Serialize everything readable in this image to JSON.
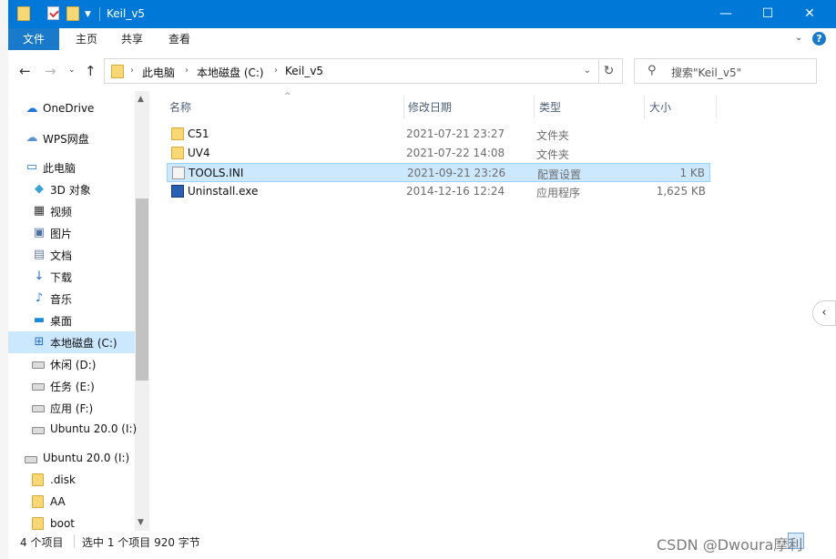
{
  "window": {
    "title": "Keil_v5",
    "minimize_glyph": "—",
    "maximize_glyph": "☐",
    "close_glyph": "✕"
  },
  "ribbon": {
    "tabs": [
      "文件",
      "主页",
      "共享",
      "查看"
    ],
    "help_glyph": "?"
  },
  "address": {
    "crumbs": [
      "此电脑",
      "本地磁盘 (C:)",
      "Keil_v5"
    ],
    "search_placeholder": "搜索\"Keil_v5\""
  },
  "nav": {
    "items": [
      {
        "label": "OneDrive",
        "icon": "cloud-icon"
      },
      {
        "label": "WPS网盘",
        "icon": "cloud-outline-icon"
      },
      {
        "label": "此电脑",
        "icon": "computer-icon"
      },
      {
        "label": "3D 对象",
        "icon": "cube-icon"
      },
      {
        "label": "视频",
        "icon": "video-icon"
      },
      {
        "label": "图片",
        "icon": "picture-icon"
      },
      {
        "label": "文档",
        "icon": "document-icon"
      },
      {
        "label": "下载",
        "icon": "download-icon"
      },
      {
        "label": "音乐",
        "icon": "music-icon"
      },
      {
        "label": "桌面",
        "icon": "desktop-icon"
      },
      {
        "label": "本地磁盘 (C:)",
        "icon": "windows-drive-icon"
      },
      {
        "label": "休闲 (D:)",
        "icon": "drive-icon"
      },
      {
        "label": "任务 (E:)",
        "icon": "drive-icon"
      },
      {
        "label": "应用 (F:)",
        "icon": "drive-icon"
      },
      {
        "label": "Ubuntu 20.0 (I:)",
        "icon": "drive-icon"
      },
      {
        "label": "Ubuntu 20.0 (I:)",
        "icon": "drive-icon"
      },
      {
        "label": ".disk",
        "icon": "folder-icon"
      },
      {
        "label": "AA",
        "icon": "folder-icon"
      },
      {
        "label": "boot",
        "icon": "folder-icon"
      }
    ],
    "selected_index": 10
  },
  "columns": {
    "name": "名称",
    "date": "修改日期",
    "type": "类型",
    "size": "大小"
  },
  "files": [
    {
      "name": "C51",
      "date": "2021-07-21 23:27",
      "type": "文件夹",
      "size": "",
      "icon": "folder-icon"
    },
    {
      "name": "UV4",
      "date": "2021-07-22 14:08",
      "type": "文件夹",
      "size": "",
      "icon": "folder-icon"
    },
    {
      "name": "TOOLS.INI",
      "date": "2021-09-21 23:26",
      "type": "配置设置",
      "size": "1 KB",
      "icon": "settings-file-icon"
    },
    {
      "name": "Uninstall.exe",
      "date": "2014-12-16 12:24",
      "type": "应用程序",
      "size": "1,625 KB",
      "icon": "application-icon"
    }
  ],
  "selected_file_index": 2,
  "status": {
    "count": "4 个项目",
    "selection": "选中 1 个项目  920 字节"
  },
  "watermark": "CSDN @Dwoura摩利",
  "colors": {
    "titlebar": "#0078d7",
    "file_tab": "#1979ca",
    "selection": "#cce8ff",
    "selection_border": "#99d1ff",
    "folder": "#f8d775"
  }
}
